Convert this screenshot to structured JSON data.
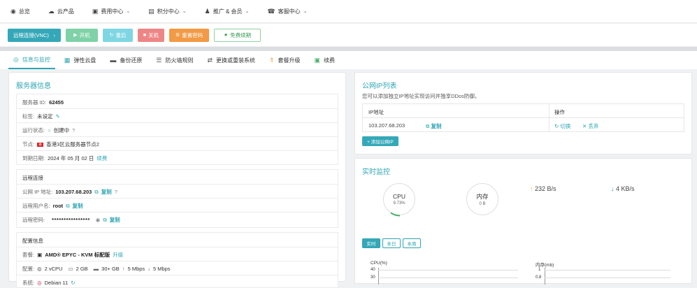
{
  "nav": {
    "items": [
      {
        "icon": "dashboard-icon",
        "glyph": "◉",
        "label": "总览",
        "dropdown": false
      },
      {
        "icon": "cloud-products-icon",
        "glyph": "☁",
        "label": "云产品",
        "dropdown": false
      },
      {
        "icon": "billing-icon",
        "glyph": "▣",
        "label": "费用中心",
        "dropdown": true
      },
      {
        "icon": "points-icon",
        "glyph": "▤",
        "label": "积分中心",
        "dropdown": true
      },
      {
        "icon": "members-icon",
        "glyph": "♟",
        "label": "推广 & 会员",
        "dropdown": true
      },
      {
        "icon": "support-icon",
        "glyph": "☎",
        "label": "客服中心",
        "dropdown": true
      }
    ]
  },
  "actions": [
    {
      "name": "remote-vnc-button",
      "label": "远程连接(VNC)",
      "glyph": "›",
      "bg": "#35a8b8",
      "w": 76
    },
    {
      "name": "power-on-button",
      "label": "开机",
      "glyph": "▶",
      "bg": "#7fd2a8",
      "w": 46
    },
    {
      "name": "restart-button",
      "label": "重启",
      "glyph": "↻",
      "bg": "#7fd6e3",
      "w": 43
    },
    {
      "name": "power-off-button",
      "label": "关机",
      "glyph": "■",
      "bg": "#ee8585",
      "w": 38
    },
    {
      "name": "reset-password-button",
      "label": "重置密码",
      "glyph": "⚙",
      "bg": "#f29a45",
      "w": 57
    },
    {
      "name": "free-renew-button",
      "label": "免费续期",
      "glyph": "★",
      "bg": "#ffffff",
      "fg": "#3a9a55",
      "border": "#8fd19e",
      "w": 67
    }
  ],
  "tabs": [
    {
      "icon": "info-icon",
      "glyph": "◎",
      "label": "信息与监控",
      "active": true
    },
    {
      "icon": "disk-icon",
      "glyph": "▦",
      "label": "弹性云盘",
      "active": false
    },
    {
      "icon": "backup-icon",
      "glyph": "▬",
      "label": "备份还原",
      "active": false
    },
    {
      "icon": "firewall-icon",
      "glyph": "☰",
      "label": "防火墙规则",
      "active": false
    },
    {
      "icon": "reinstall-icon",
      "glyph": "⇄",
      "label": "更换或重装系统",
      "active": false
    },
    {
      "icon": "upgrade-icon",
      "glyph": "⇑",
      "label": "套餐升级",
      "active": false
    },
    {
      "icon": "renew-icon",
      "glyph": "▣",
      "label": "续费",
      "active": false
    }
  ],
  "server": {
    "title": "服务器信息",
    "id_label": "服务器 ID:",
    "id_value": "62455",
    "tag_label": "标签:",
    "tag_value": "未设定",
    "status_label": "运行状态:",
    "status_value": "创建中",
    "node_label": "节点:",
    "node_value": "香港3区云服务器节点2",
    "expire_label": "到期日期:",
    "expire_value": "2024 年 05 月 02 日",
    "renew_link": "续费"
  },
  "remote": {
    "title": "远程连接",
    "ip_label": "公网 IP 地址:",
    "ip_value": "103.207.68.203",
    "copy": "复制",
    "user_label": "远程用户名:",
    "user_value": "root",
    "pwd_label": "远程密码:",
    "pwd_value": "****************"
  },
  "config": {
    "title": "配置信息",
    "pkg_label": "套餐:",
    "pkg_value": "AMD® EPYC - KVM 标配版",
    "upgrade_link": "升级",
    "spec_label": "配置:",
    "cpu": "2 vCPU",
    "ram": "2 GB",
    "disk": "30+ GB",
    "up": "5 Mbps",
    "down": "5 Mbps",
    "os_label": "系统:",
    "os_value": "Debian 11"
  },
  "public_ip": {
    "title": "公网IP列表",
    "desc": "您可以添加独立IP地址实现访问并独享DDos防御。",
    "col_ip": "IP地址",
    "col_ops": "操作",
    "row_ip": "103.207.68.203",
    "copy": "复制",
    "switch": "切换",
    "discard": "丢弃",
    "add_button": "+ 添加公网IP"
  },
  "monitor": {
    "title": "实时监控",
    "cpu_label": "CPU",
    "cpu_percent": "9.73%",
    "cpu_fraction": 0.0973,
    "mem_label": "内存",
    "mem_value": "0 B",
    "up_rate": "232 B/s",
    "down_rate": "4 KB/s",
    "range_buttons": [
      "实时",
      "本日",
      "本周"
    ],
    "cpu_chart_title": "CPU(%)",
    "cpu_ticks": [
      "40",
      "30"
    ],
    "mem_chart_title": "内存(mb)",
    "mem_ticks": [
      "1",
      "0.8"
    ]
  },
  "colors": {
    "accent": "#2ea5b4",
    "status_green": "#4cae6a",
    "copy_blue": "#2e8fb8"
  }
}
